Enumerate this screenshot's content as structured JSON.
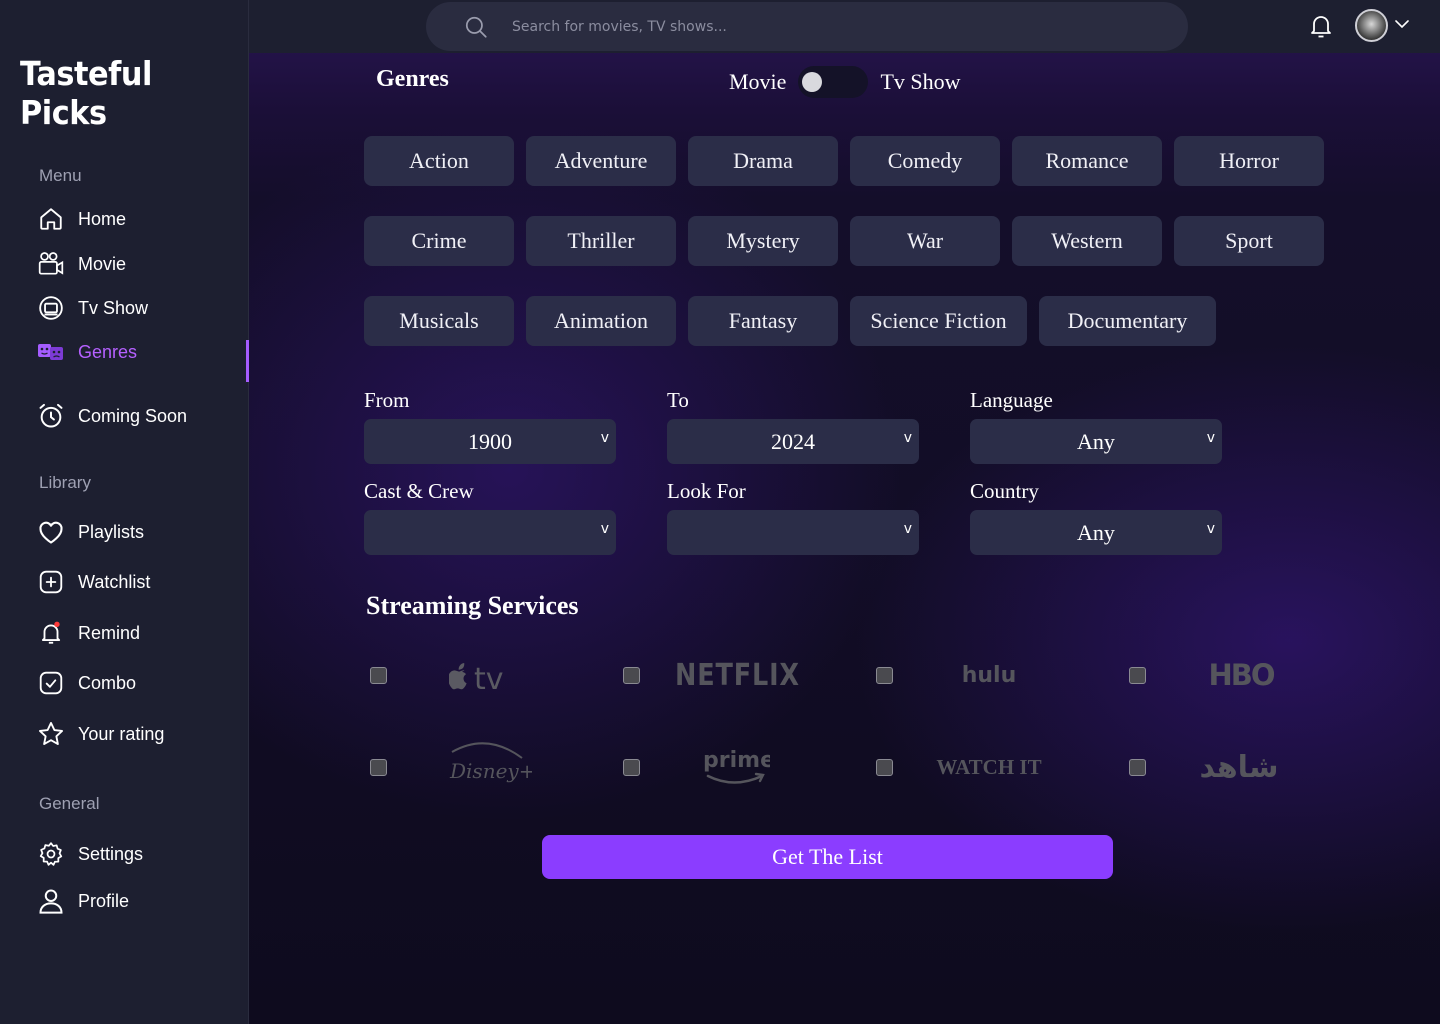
{
  "app": {
    "title": "Tasteful Picks"
  },
  "sidebar": {
    "menu_label": "Menu",
    "menu": [
      {
        "label": "Home",
        "icon": "home-icon"
      },
      {
        "label": "Movie",
        "icon": "movie-camera-icon"
      },
      {
        "label": "Tv Show",
        "icon": "tv-icon"
      },
      {
        "label": "Genres",
        "icon": "genres-masks-icon",
        "active": true
      },
      {
        "label": "Coming Soon",
        "icon": "alarm-clock-icon"
      }
    ],
    "library_label": "Library",
    "library": [
      {
        "label": "Playlists",
        "icon": "heart-icon"
      },
      {
        "label": "Watchlist",
        "icon": "plus-square-icon"
      },
      {
        "label": "Remind",
        "icon": "bell-dot-icon"
      },
      {
        "label": "Combo",
        "icon": "check-square-icon"
      },
      {
        "label": "Your rating",
        "icon": "star-icon"
      }
    ],
    "general_label": "General",
    "general": [
      {
        "label": "Settings",
        "icon": "gear-icon"
      },
      {
        "label": "Profile",
        "icon": "user-icon"
      }
    ],
    "accent_color": "#b560ff"
  },
  "header": {
    "search_placeholder": "Search for movies, TV shows..."
  },
  "genres": {
    "title": "Genres",
    "toggle_left": "Movie",
    "toggle_right": "Tv Show",
    "items": [
      "Action",
      "Adventure",
      "Drama",
      "Comedy",
      "Romance",
      "Horror",
      "Crime",
      "Thriller",
      "Mystery",
      "War",
      "Western",
      "Sport",
      "Musicals",
      "Animation",
      "Fantasy",
      "Science Fiction",
      "Documentary"
    ]
  },
  "filters": {
    "from": {
      "label": "From",
      "value": "1900"
    },
    "to": {
      "label": "To",
      "value": "2024"
    },
    "language": {
      "label": "Language",
      "value": "Any"
    },
    "cast": {
      "label": "Cast & Crew",
      "value": ""
    },
    "look_for": {
      "label": "Look For",
      "value": ""
    },
    "country": {
      "label": "Country",
      "value": "Any"
    },
    "caret": "v"
  },
  "streaming": {
    "title": "Streaming Services",
    "services": [
      {
        "name": "Apple TV",
        "icon": "apple-tv-logo",
        "text": "tv"
      },
      {
        "name": "Netflix",
        "icon": "netflix-logo",
        "text": "NETFLIX"
      },
      {
        "name": "Hulu",
        "icon": "hulu-logo",
        "text": "hulu"
      },
      {
        "name": "HBO",
        "icon": "hbo-logo",
        "text": "HBO"
      },
      {
        "name": "Disney+",
        "icon": "disney-plus-logo",
        "text": "Disney+"
      },
      {
        "name": "Prime Video",
        "icon": "prime-video-logo",
        "text": "prime"
      },
      {
        "name": "WATCH IT",
        "icon": "watchit-logo",
        "text": "WATCH IT"
      },
      {
        "name": "Shahid",
        "icon": "shahid-logo",
        "text": "شاهد"
      }
    ],
    "checked": [
      false,
      false,
      false,
      false,
      false,
      false,
      false,
      false
    ]
  },
  "cta": {
    "label": "Get The List",
    "color": "#8b3dff"
  }
}
